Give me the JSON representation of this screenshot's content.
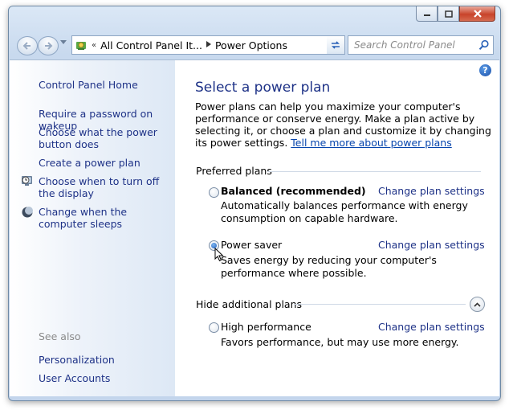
{
  "window": {
    "caption_buttons": {
      "minimize_icon": "minimize-icon",
      "maximize_icon": "maximize-icon",
      "close_icon": "close-icon"
    }
  },
  "navbar": {
    "back_icon": "back-arrow-icon",
    "forward_icon": "forward-arrow-icon",
    "address": {
      "overflow_marker": "«",
      "crumbs": [
        "All Control Panel It...",
        "Power Options"
      ]
    },
    "search": {
      "placeholder": "Search Control Panel"
    }
  },
  "sidebar": {
    "home": "Control Panel Home",
    "links": [
      {
        "label": "Require a password on wakeup"
      },
      {
        "label": "Choose what the power button does"
      },
      {
        "label": "Create a power plan"
      },
      {
        "label": "Choose when to turn off the display",
        "icon": "display-clock-icon"
      },
      {
        "label": "Change when the computer sleeps",
        "icon": "moon-icon"
      }
    ],
    "see_also": {
      "heading": "See also",
      "links": [
        "Personalization",
        "User Accounts"
      ]
    }
  },
  "main": {
    "title": "Select a power plan",
    "intro_text": "Power plans can help you maximize your computer's performance or conserve energy. Make a plan active by selecting it, or choose a plan and customize it by changing its power settings.",
    "intro_link": "Tell me more about power plans",
    "preferred_heading": "Preferred plans",
    "additional_heading": "Hide additional plans",
    "plans": [
      {
        "name": "Balanced (recommended)",
        "selected": false,
        "bold": true,
        "description": "Automatically balances performance with energy consumption on capable hardware.",
        "change_link": "Change plan settings"
      },
      {
        "name": "Power saver",
        "selected": true,
        "bold": false,
        "description": "Saves energy by reducing your computer's performance where possible.",
        "change_link": "Change plan settings"
      },
      {
        "name": "High performance",
        "selected": false,
        "bold": false,
        "description": "Favors performance, but may use more energy.",
        "change_link": "Change plan settings"
      }
    ]
  }
}
